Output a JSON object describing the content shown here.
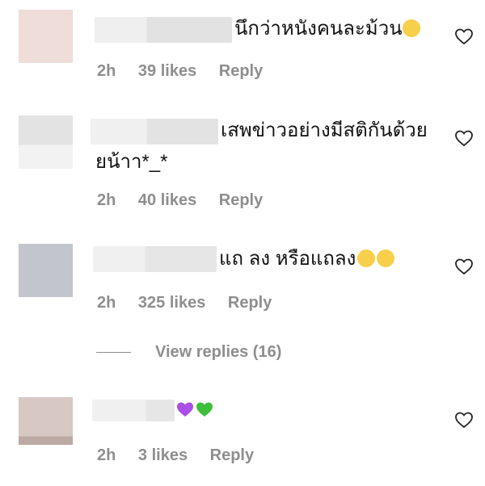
{
  "comments": [
    {
      "text": "นึกว่าหนังคนละม้วน",
      "time": "2h",
      "likes": "39 likes",
      "reply": "Reply",
      "emoji": "slightly-frowning-face"
    },
    {
      "text_line1": "เสพข่าวอย่างมีสติกันด้วย",
      "text_line2": "ยน้าา*_*",
      "time": "2h",
      "likes": "40 likes",
      "reply": "Reply"
    },
    {
      "text": "แถ ลง หรือแถลง",
      "time": "2h",
      "likes": "325 likes",
      "reply": "Reply",
      "emoji": "crying-face"
    },
    {
      "text": "",
      "time": "2h",
      "likes": "3 likes",
      "reply": "Reply",
      "emoji": "purple-heart green-heart"
    }
  ],
  "view_replies": "View replies (16)",
  "colors": {
    "meta_gray": "#8e8e8e",
    "purple_heart": "#a94ee6",
    "green_heart": "#3dbf3a"
  }
}
